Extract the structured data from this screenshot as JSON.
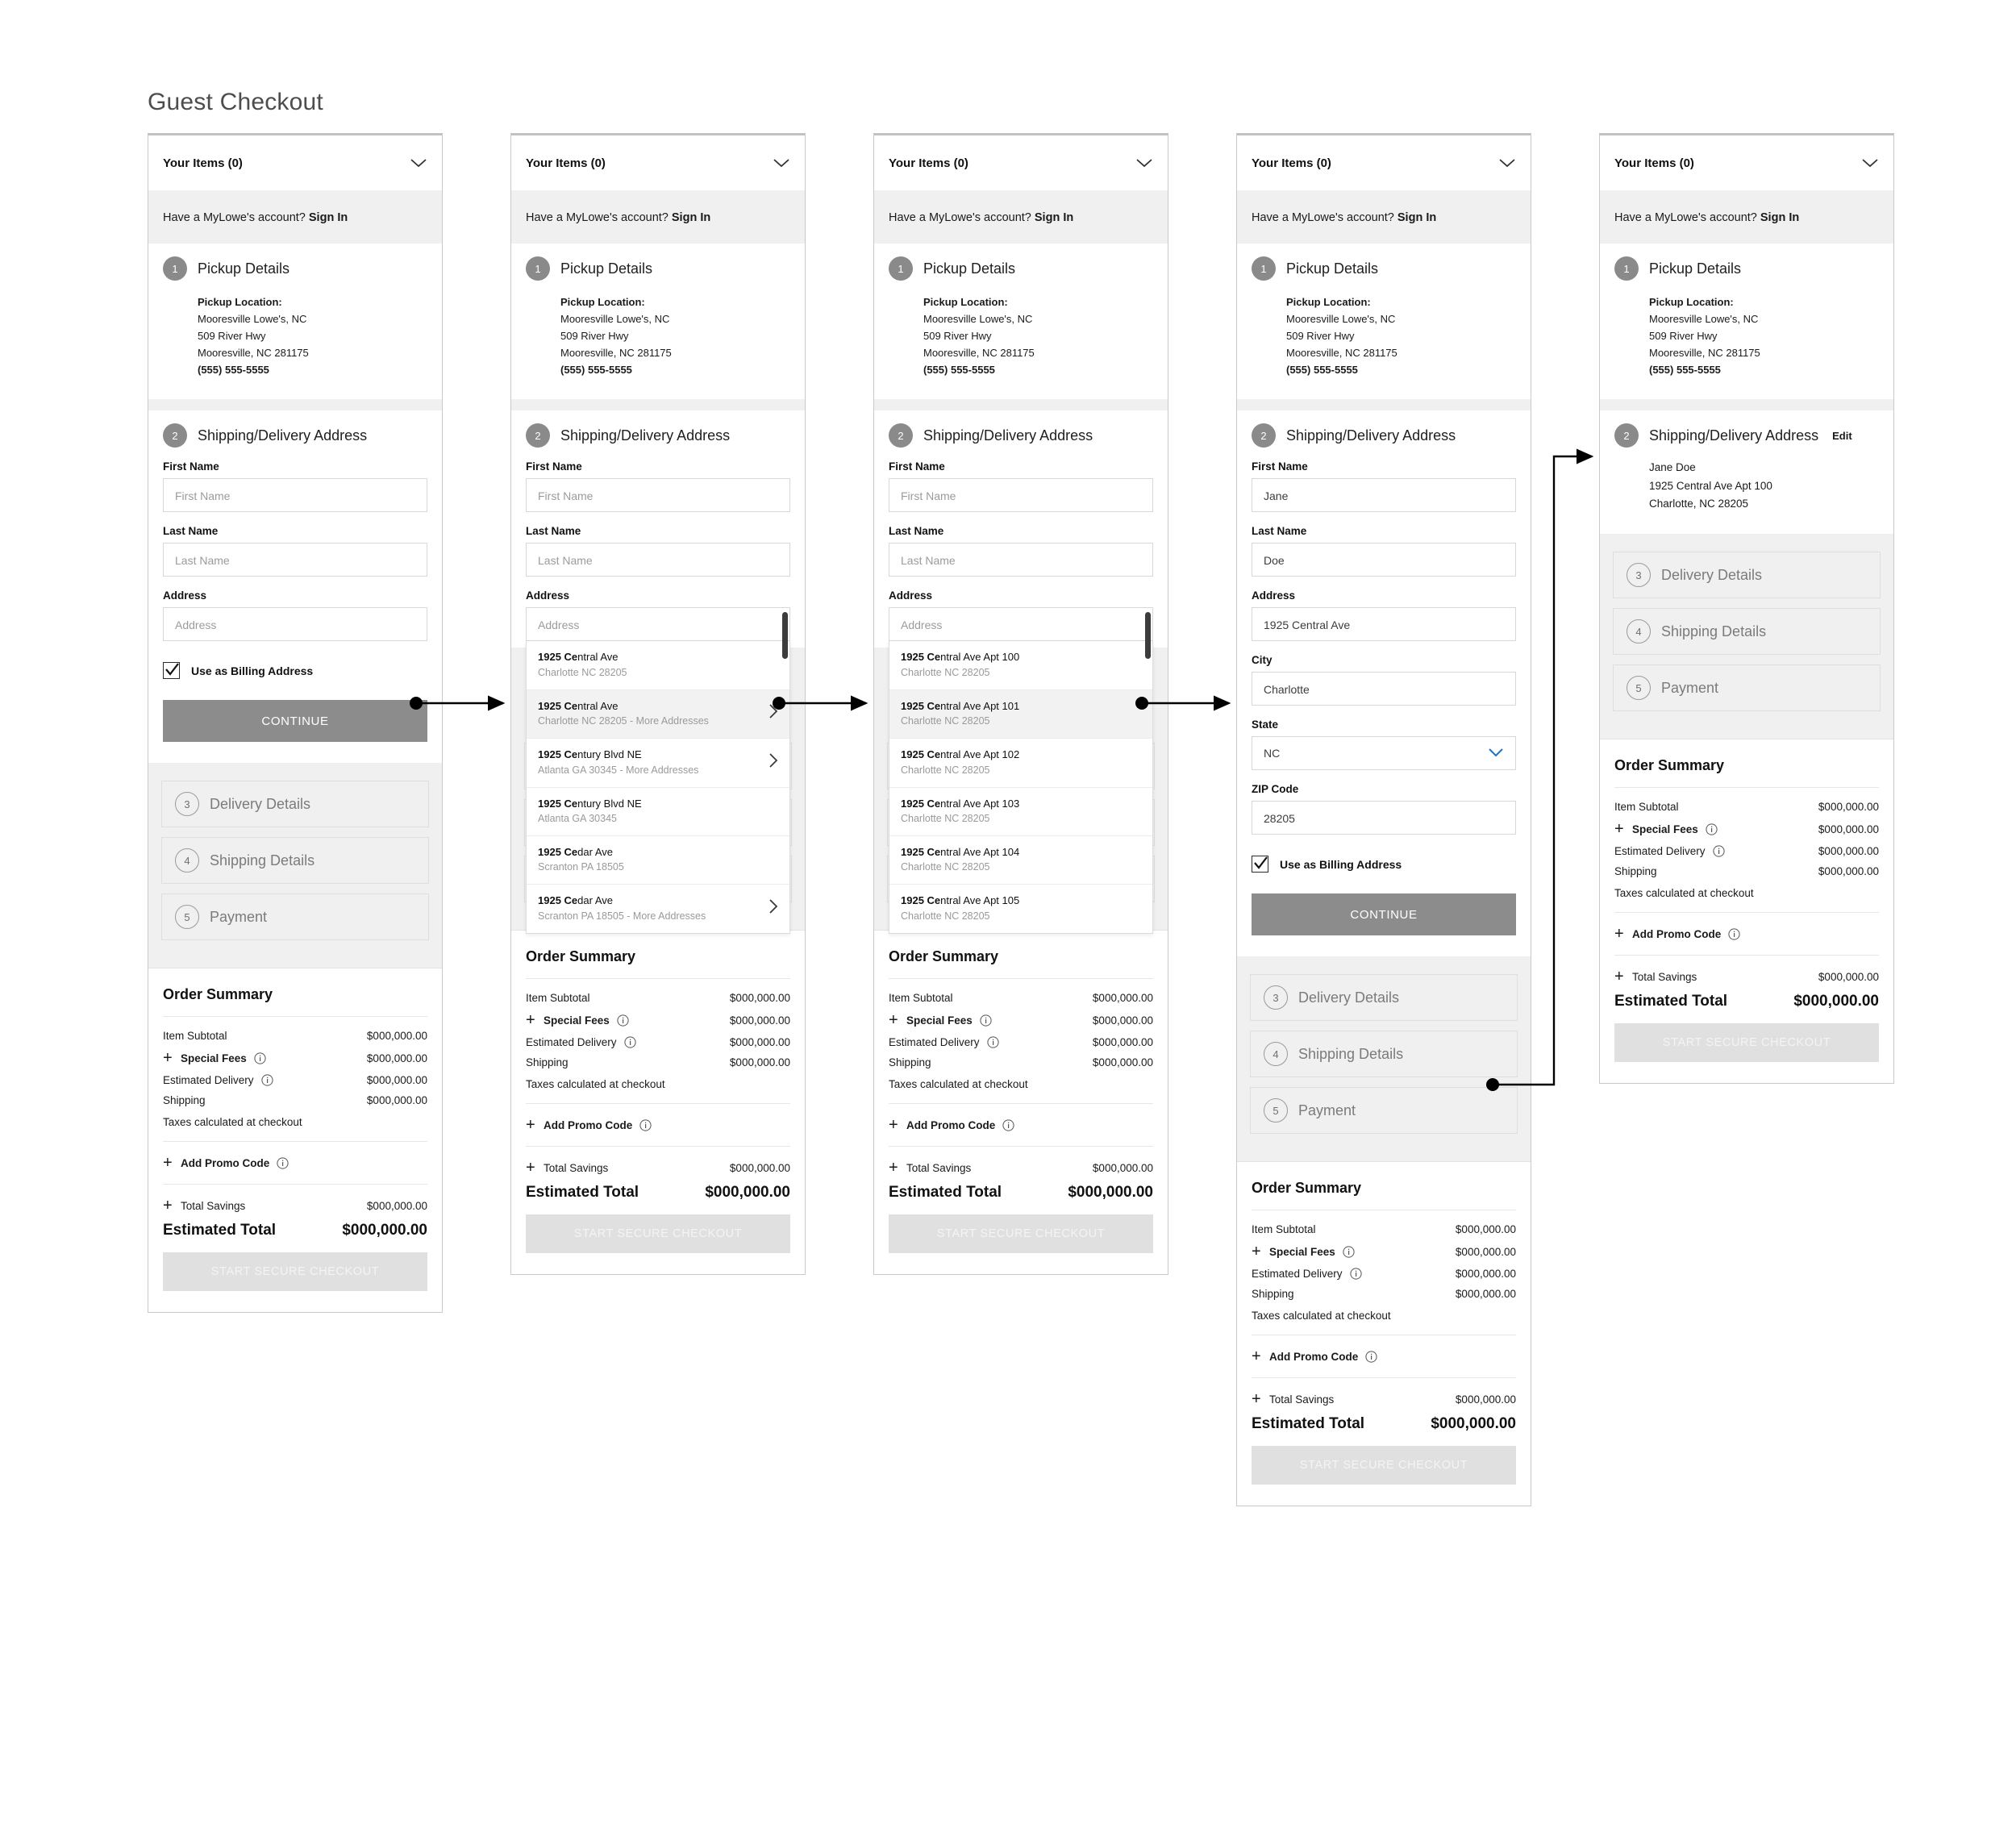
{
  "page": {
    "title": "Guest Checkout"
  },
  "common": {
    "items_label": "Your Items (0)",
    "signin_prefix": "Have a MyLowe's account? ",
    "signin_link": "Sign In",
    "step1_num": "1",
    "step1_title": "Pickup Details",
    "pickup_location_label": "Pickup Location:",
    "pickup_line1": "Mooresville Lowe's, NC",
    "pickup_line2": "509 River Hwy",
    "pickup_line3": "Mooresville, NC 281175",
    "pickup_phone": "(555) 555-5555",
    "step2_num": "2",
    "step2_title": "Shipping/Delivery Address",
    "step2_edit": "Edit",
    "step3_num": "3",
    "step3_title": "Delivery Details",
    "step4_num": "4",
    "step4_title": "Shipping Details",
    "step5_num": "5",
    "step5_title": "Payment",
    "first_name_label": "First Name",
    "first_name_placeholder": "First Name",
    "last_name_label": "Last Name",
    "last_name_placeholder": "Last Name",
    "address_label": "Address",
    "address_placeholder": "Address",
    "city_label": "City",
    "state_label": "State",
    "zip_label": "ZIP Code",
    "billing_label": "Use as Billing Address",
    "continue_label": "CONTINUE"
  },
  "summary": {
    "title": "Order Summary",
    "item_subtotal_label": "Item Subtotal",
    "item_subtotal_value": "$000,000.00",
    "special_fees_label": "Special Fees",
    "special_fees_value": "$000,000.00",
    "estimated_delivery_label": "Estimated Delivery",
    "estimated_delivery_value": "$000,000.00",
    "shipping_label": "Shipping",
    "shipping_value": "$000,000.00",
    "taxes_note": "Taxes calculated at checkout",
    "promo_label": "Add Promo Code",
    "total_savings_label": "Total Savings",
    "total_savings_value": "$000,000.00",
    "estimated_total_label": "Estimated Total",
    "estimated_total_value": "$000,000.00",
    "checkout_label": "START SECURE CHECKOUT"
  },
  "col4": {
    "first_name_value": "Jane",
    "last_name_value": "Doe",
    "address_value": "1925 Central Ave",
    "city_value": "Charlotte",
    "state_value": "NC",
    "zip_value": "28205"
  },
  "col5": {
    "addr_name": "Jane Doe",
    "addr_street": "1925 Central Ave Apt 100",
    "addr_citystatezip": "Charlotte, NC 28205"
  },
  "suggestions_street": [
    {
      "main_bold": "1925 Ce",
      "main_rest": "ntral Ave",
      "sub": "Charlotte NC 28205",
      "chevron": false,
      "highlight": false
    },
    {
      "main_bold": "1925 Ce",
      "main_rest": "ntral Ave",
      "sub": "Charlotte NC 28205 - More Addresses",
      "chevron": true,
      "highlight": true
    },
    {
      "main_bold": "1925 Ce",
      "main_rest": "ntury Blvd NE",
      "sub": "Atlanta GA 30345 - More Addresses",
      "chevron": true,
      "highlight": false
    },
    {
      "main_bold": "1925 Ce",
      "main_rest": "ntury Blvd NE",
      "sub": "Atlanta GA 30345",
      "chevron": false,
      "highlight": false
    },
    {
      "main_bold": "1925 Ce",
      "main_rest": "dar Ave",
      "sub": "Scranton PA 18505",
      "chevron": false,
      "highlight": false
    },
    {
      "main_bold": "1925 Ce",
      "main_rest": "dar Ave",
      "sub": "Scranton PA 18505 - More Addresses",
      "chevron": true,
      "highlight": false
    }
  ],
  "suggestions_apt": [
    {
      "main_bold": "1925 Ce",
      "main_rest": "ntral Ave Apt 100",
      "sub": "Charlotte NC 28205",
      "chevron": false,
      "highlight": false
    },
    {
      "main_bold": "1925 Ce",
      "main_rest": "ntral Ave Apt 101",
      "sub": "Charlotte NC 28205",
      "chevron": false,
      "highlight": true
    },
    {
      "main_bold": "1925 Ce",
      "main_rest": "ntral Ave Apt 102",
      "sub": "Charlotte NC 28205",
      "chevron": false,
      "highlight": false
    },
    {
      "main_bold": "1925 Ce",
      "main_rest": "ntral Ave Apt 103",
      "sub": "Charlotte NC 28205",
      "chevron": false,
      "highlight": false
    },
    {
      "main_bold": "1925 Ce",
      "main_rest": "ntral Ave Apt 104",
      "sub": "Charlotte NC 28205",
      "chevron": false,
      "highlight": false
    },
    {
      "main_bold": "1925 Ce",
      "main_rest": "ntral Ave Apt 105",
      "sub": "Charlotte NC 28205",
      "chevron": false,
      "highlight": false
    }
  ],
  "colors": {
    "badge_filled": "#8a8a8a",
    "continue_button": "#8c8c8c",
    "checkout_button": "#e0e0e0",
    "select_chevron": "#1a73c7",
    "panel_grey": "#f0f0f0"
  }
}
